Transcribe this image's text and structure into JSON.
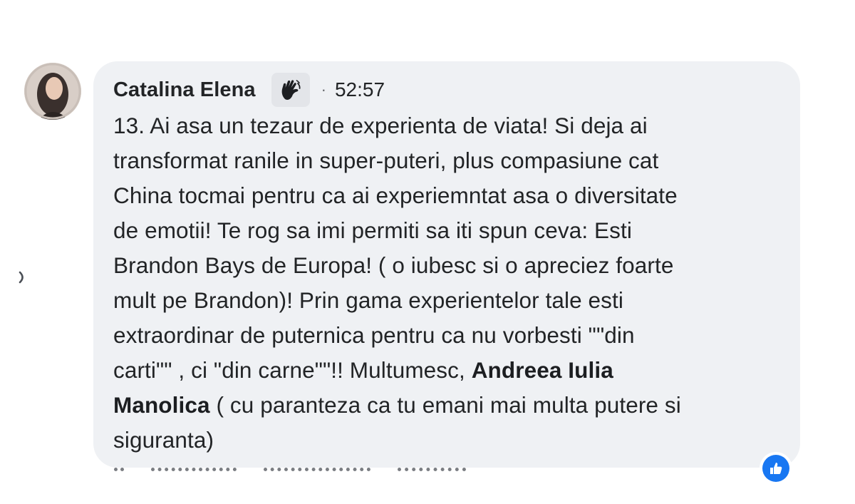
{
  "comment": {
    "author": "Catalina Elena",
    "timestamp": "52:57",
    "separator": "·",
    "badge_icon": "waving-hand-icon",
    "lines": [
      "13. Ai asa un tezaur de experienta de viata! Si deja ai",
      "transformat ranile in super-puteri, plus compasiune cat",
      "China tocmai pentru ca ai experiemntat asa o diversitate",
      "de emotii! Te rog sa imi permiti sa iti spun ceva: Esti",
      "Brandon Bays de Europa! ( o iubesc si o apreciez foarte",
      "mult pe Brandon)! Prin gama experientelor tale esti",
      "extraordinar de puternica pentru ca nu vorbesti \"\"din",
      "Manolica",
      "siguranta)"
    ],
    "line8_text": "carti\"\" , ci \"din carne\"\"!! Multumesc, ",
    "mention_part1": "Andreea Iulia",
    "line9_rest": " ( cu paranteza ca tu emani mai multa putere si",
    "reaction_icon": "like-icon",
    "colors": {
      "bubble": "#eff1f4",
      "text": "#222426",
      "like": "#1877f2"
    }
  }
}
